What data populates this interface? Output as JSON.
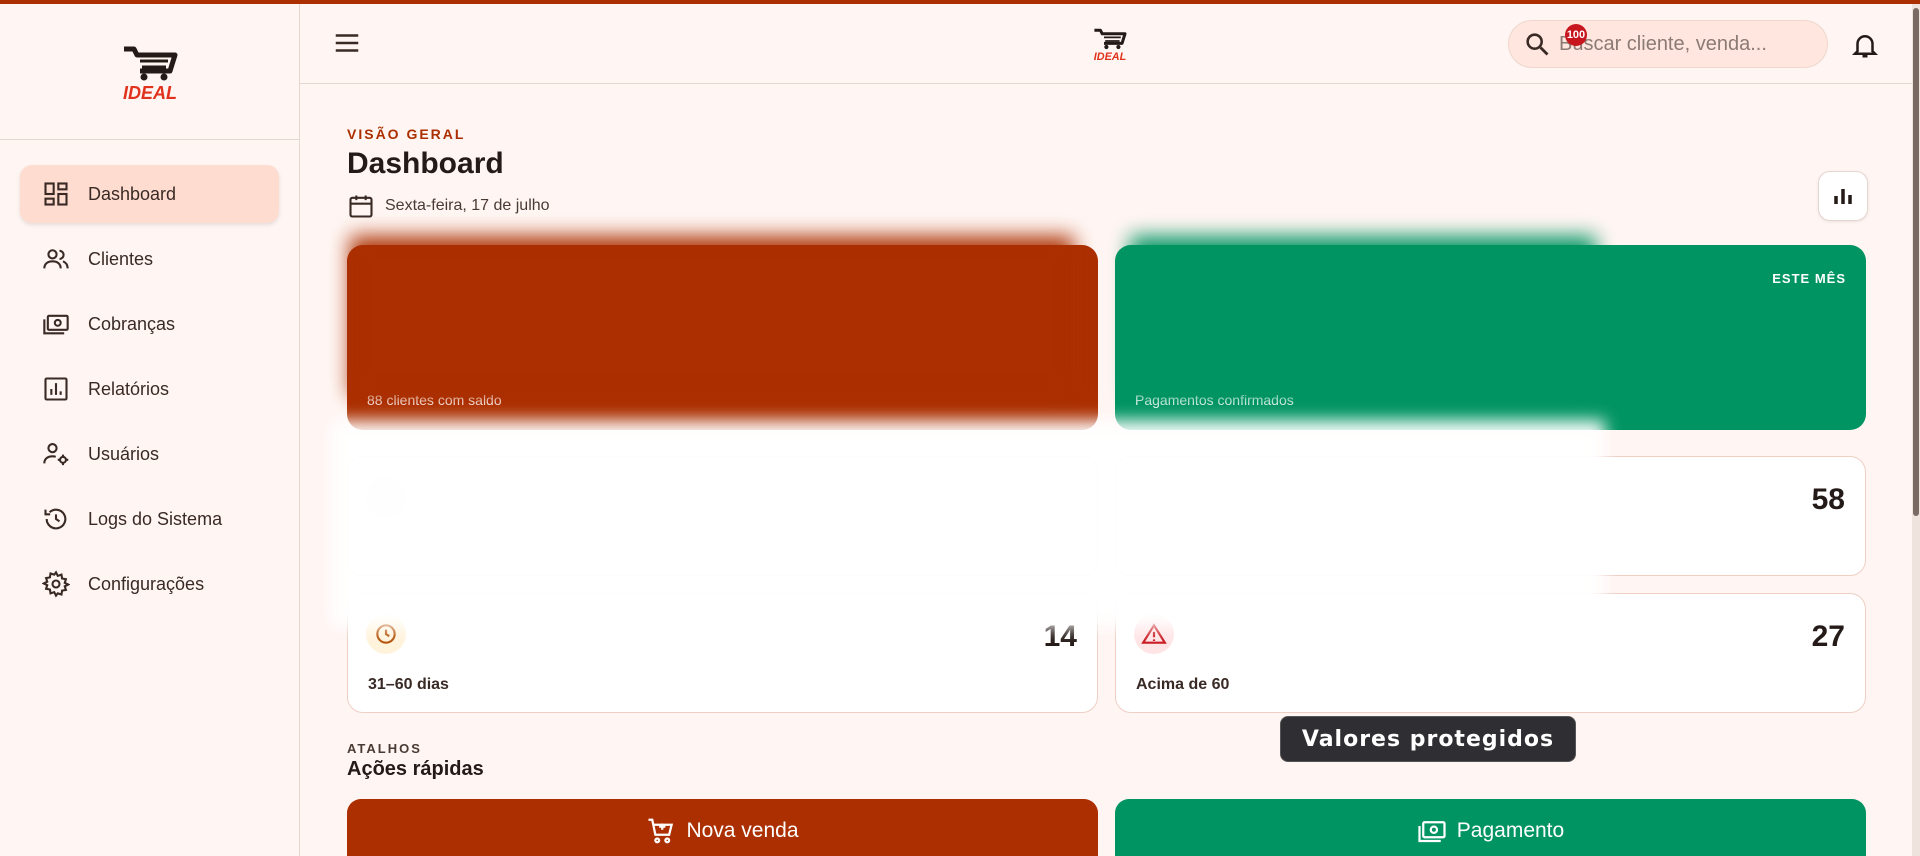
{
  "brand": {
    "logo_text": "IDEAL",
    "accent": "#ab2f00",
    "success": "#009462"
  },
  "sidebar": {
    "items": [
      {
        "label": "Dashboard",
        "icon": "dashboard-icon",
        "active": true
      },
      {
        "label": "Clientes",
        "icon": "users-icon"
      },
      {
        "label": "Cobranças",
        "icon": "money-icon"
      },
      {
        "label": "Relatórios",
        "icon": "report-icon"
      },
      {
        "label": "Usuários",
        "icon": "user-settings-icon"
      },
      {
        "label": "Logs do Sistema",
        "icon": "history-icon"
      },
      {
        "label": "Configurações",
        "icon": "gear-icon"
      }
    ]
  },
  "header": {
    "search_placeholder": "Buscar cliente, venda...",
    "notification_count": "100"
  },
  "main": {
    "eyebrow": "VISÃO GERAL",
    "title": "Dashboard",
    "date": "Sexta-feira, 17 de julho",
    "hero_cards": [
      {
        "tag": "",
        "subtitle": "88 clientes com saldo",
        "color": "#ab2f00"
      },
      {
        "tag": "ESTE MÊS",
        "subtitle": "Pagamentos confirmados",
        "color": "#009462"
      }
    ],
    "stats": [
      {
        "value": "58",
        "label": ""
      },
      {
        "value": "14",
        "label": "31–60 dias",
        "icon": "clock-icon"
      },
      {
        "value": "27",
        "label": "Acima de 60",
        "icon": "warning-icon"
      }
    ],
    "toast": "Valores protegidos",
    "shortcuts_eyebrow": "ATALHOS",
    "shortcuts_title": "Ações rápidas",
    "quick_actions": [
      {
        "label": "Nova venda",
        "icon": "cart-add-icon"
      },
      {
        "label": "Pagamento",
        "icon": "money-icon"
      }
    ]
  }
}
